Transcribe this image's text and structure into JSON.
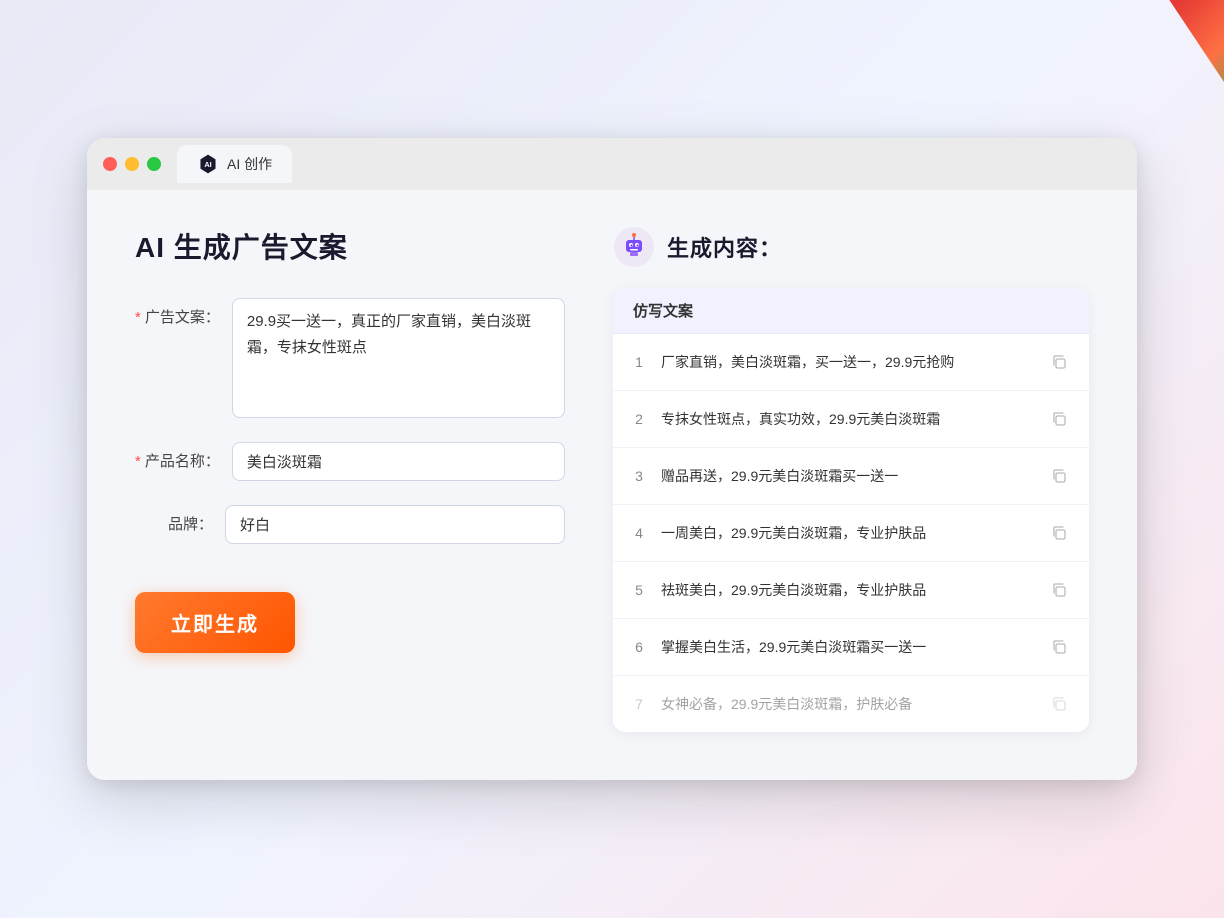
{
  "window": {
    "tab_label": "AI 创作"
  },
  "page": {
    "title": "AI 生成广告文案",
    "result_title": "生成内容："
  },
  "form": {
    "ad_label": "广告文案：",
    "ad_required": true,
    "ad_value": "29.9买一送一，真正的厂家直销，美白淡斑霜，专抹女性斑点",
    "product_label": "产品名称：",
    "product_required": true,
    "product_value": "美白淡斑霜",
    "brand_label": "品牌：",
    "brand_required": false,
    "brand_value": "好白",
    "generate_btn": "立即生成"
  },
  "result": {
    "table_header": "仿写文案",
    "rows": [
      {
        "id": 1,
        "text": "厂家直销，美白淡斑霜，买一送一，29.9元抢购",
        "dimmed": false
      },
      {
        "id": 2,
        "text": "专抹女性斑点，真实功效，29.9元美白淡斑霜",
        "dimmed": false
      },
      {
        "id": 3,
        "text": "赠品再送，29.9元美白淡斑霜买一送一",
        "dimmed": false
      },
      {
        "id": 4,
        "text": "一周美白，29.9元美白淡斑霜，专业护肤品",
        "dimmed": false
      },
      {
        "id": 5,
        "text": "祛斑美白，29.9元美白淡斑霜，专业护肤品",
        "dimmed": false
      },
      {
        "id": 6,
        "text": "掌握美白生活，29.9元美白淡斑霜买一送一",
        "dimmed": false
      },
      {
        "id": 7,
        "text": "女神必备，29.9元美白淡斑霜，护肤必备",
        "dimmed": true
      }
    ]
  }
}
